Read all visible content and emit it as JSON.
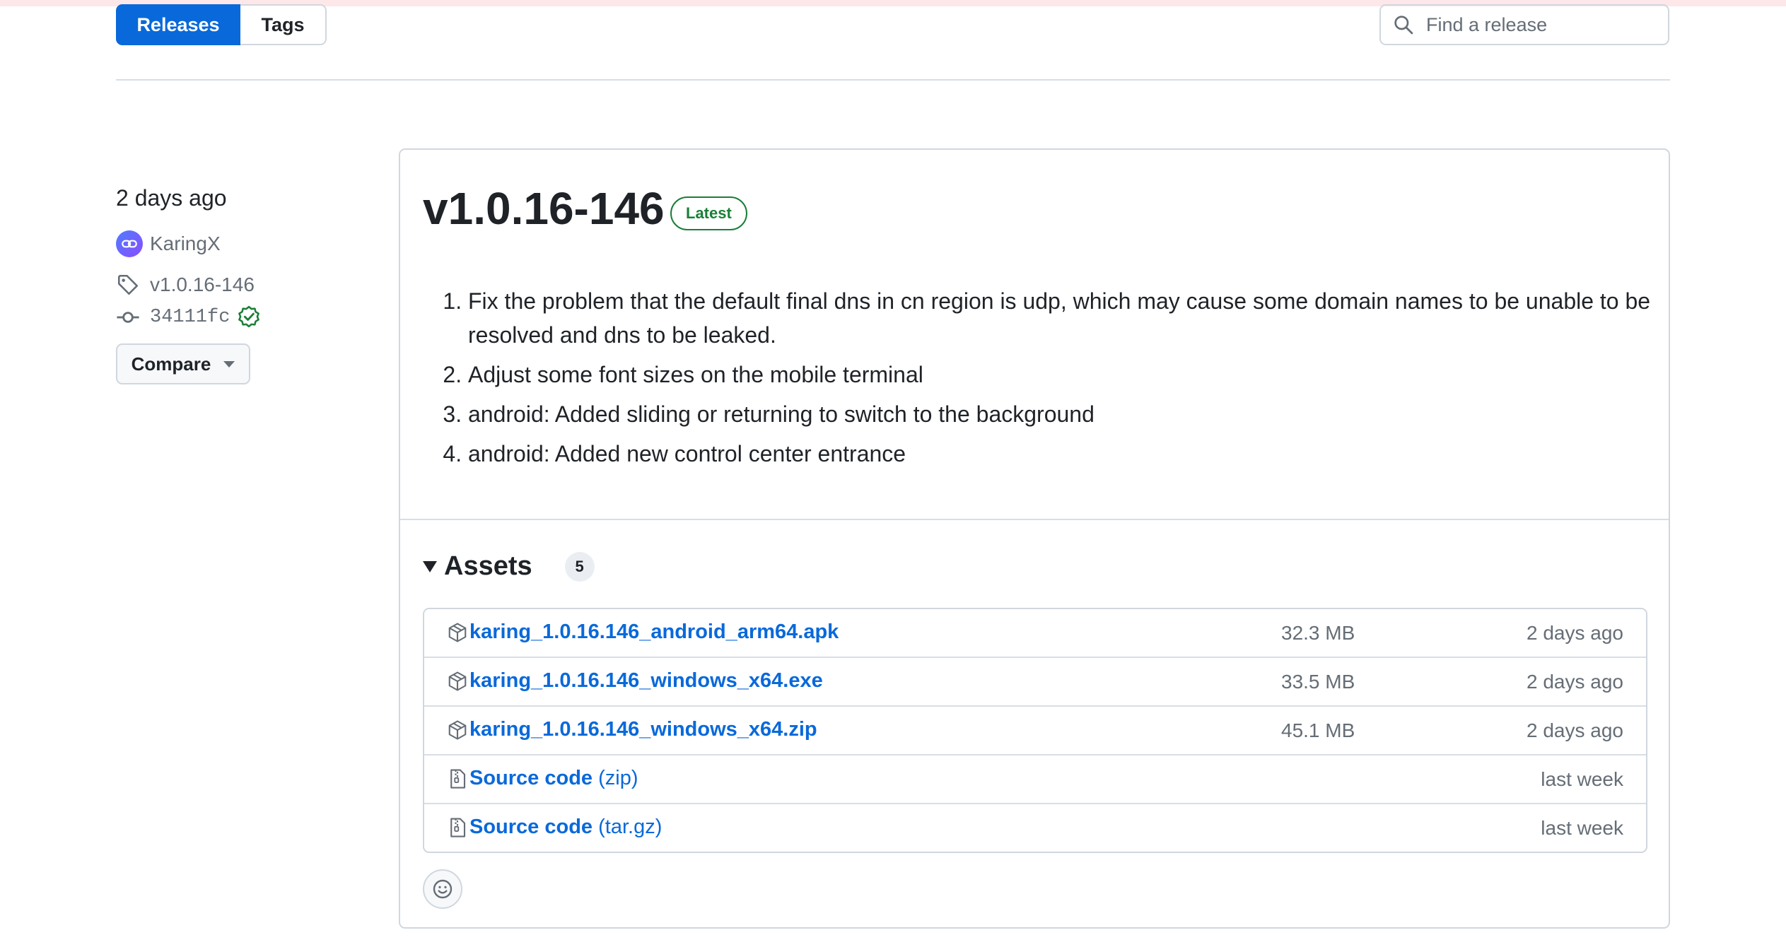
{
  "subnav": {
    "releases_label": "Releases",
    "tags_label": "Tags"
  },
  "search": {
    "placeholder": "Find a release"
  },
  "sidebar": {
    "date": "2 days ago",
    "author": "KaringX",
    "tag": "v1.0.16-146",
    "commit": "34111fc",
    "compare_label": "Compare"
  },
  "release": {
    "title": "v1.0.16-146",
    "badge": "Latest",
    "notes": [
      "Fix the problem that the default final dns in cn region is udp, which may cause some domain names to be unable to be resolved and dns to be leaked.",
      "Adjust some font sizes on the mobile terminal",
      "android: Added sliding or returning to switch to the background",
      "android: Added new control center entrance"
    ]
  },
  "assets": {
    "title": "Assets",
    "count": "5",
    "items": [
      {
        "name": "karing_1.0.16.146_android_arm64.apk",
        "ext": "",
        "size": "32.3 MB",
        "date": "2 days ago",
        "icon": "package-icon"
      },
      {
        "name": "karing_1.0.16.146_windows_x64.exe",
        "ext": "",
        "size": "33.5 MB",
        "date": "2 days ago",
        "icon": "package-icon"
      },
      {
        "name": "karing_1.0.16.146_windows_x64.zip",
        "ext": "",
        "size": "45.1 MB",
        "date": "2 days ago",
        "icon": "package-icon"
      },
      {
        "name": "Source code",
        "ext": "(zip)",
        "size": "",
        "date": "last week",
        "icon": "file-zip-icon"
      },
      {
        "name": "Source code",
        "ext": "(tar.gz)",
        "size": "",
        "date": "last week",
        "icon": "file-zip-icon"
      }
    ]
  },
  "colors": {
    "accent": "#0969da",
    "success": "#1a7f37",
    "muted": "#656d76",
    "border": "#d0d7de"
  }
}
